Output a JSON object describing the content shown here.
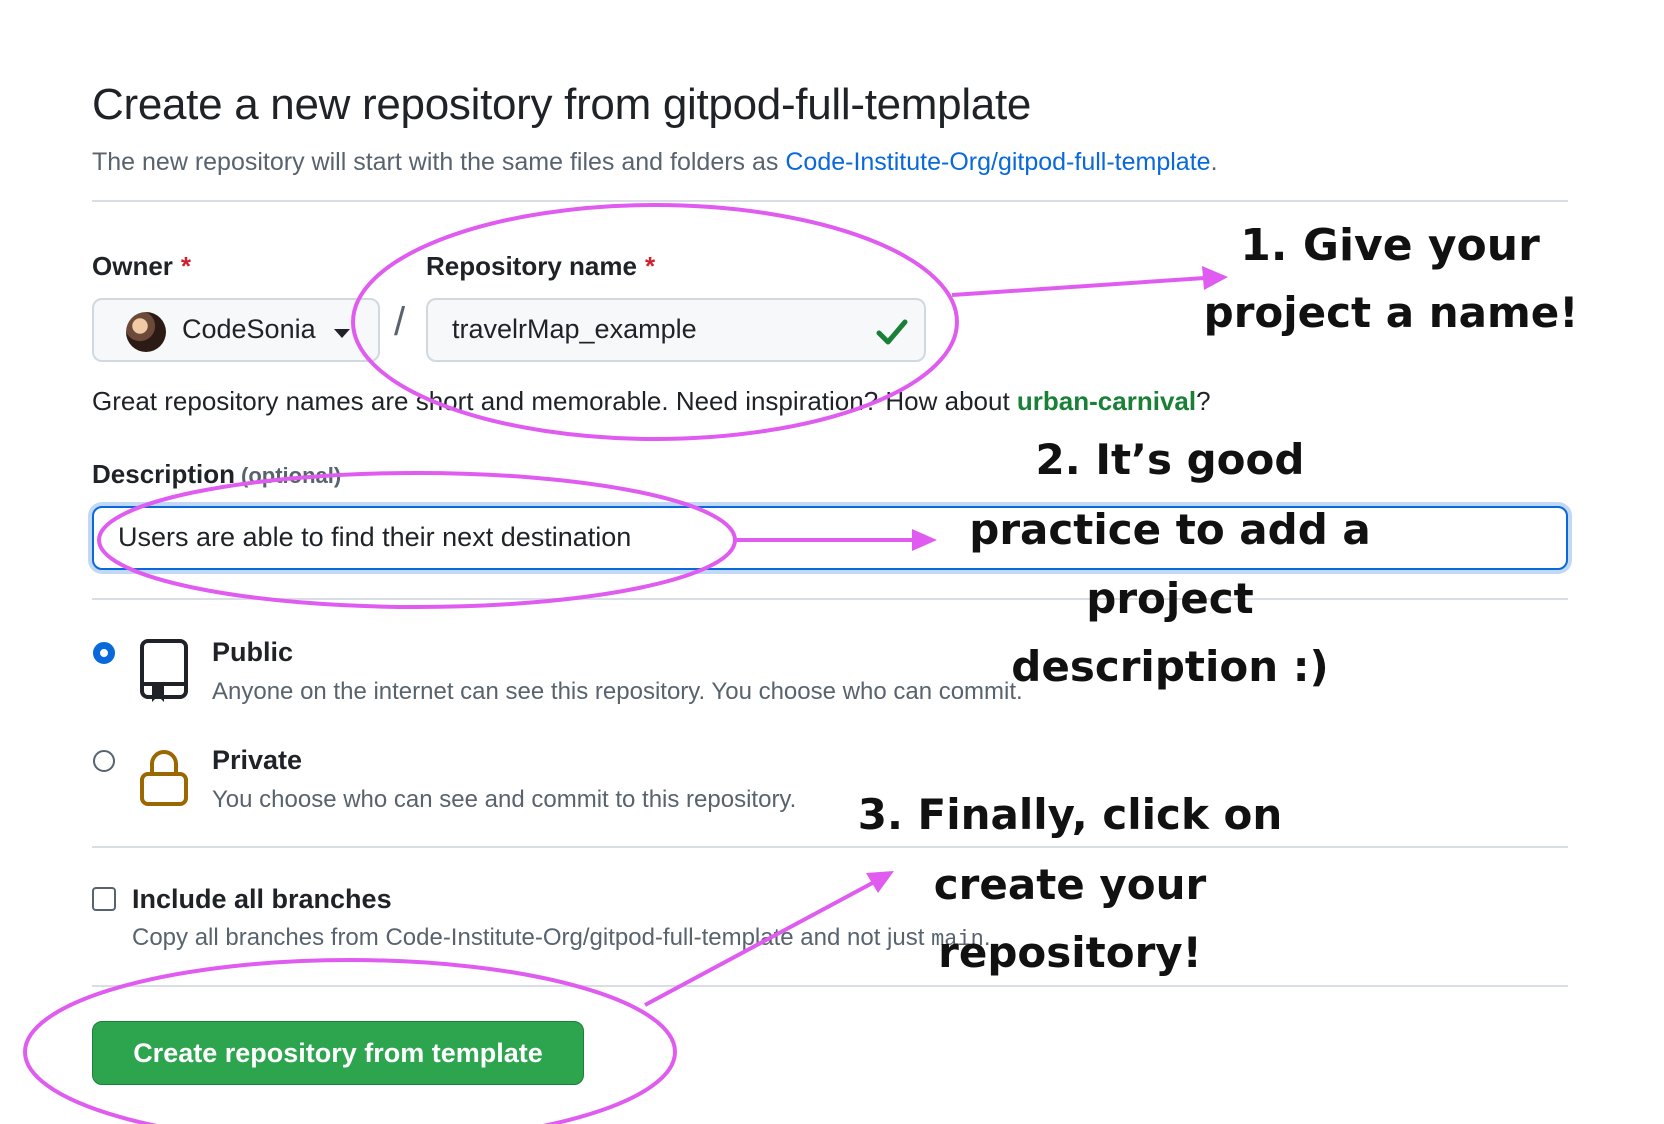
{
  "header": {
    "title": "Create a new repository from gitpod-full-template",
    "subtitle_prefix": "The new repository will start with the same files and folders as ",
    "template_link": "Code-Institute-Org/gitpod-full-template",
    "subtitle_suffix": "."
  },
  "owner": {
    "label": "Owner",
    "required_mark": "*",
    "selected": "CodeSonia"
  },
  "separator": "/",
  "repository": {
    "label": "Repository name",
    "required_mark": "*",
    "value": "travelrMap_example",
    "valid_icon": "check-icon"
  },
  "hint": {
    "prefix": "Great repository names are short and memorable. Need inspiration? How about ",
    "suggestion": "urban-carnival",
    "suffix": "?"
  },
  "description": {
    "label": "Description",
    "optional_text": "(optional)",
    "value": "Users are able to find their next destination"
  },
  "visibility": {
    "options": [
      {
        "title": "Public",
        "description": "Anyone on the internet can see this repository. You choose who can commit.",
        "icon": "repo-book-icon",
        "checked": true
      },
      {
        "title": "Private",
        "description": "You choose who can see and commit to this repository.",
        "icon": "lock-icon",
        "checked": false
      }
    ]
  },
  "branches": {
    "label": "Include all branches",
    "description_prefix": "Copy all branches from Code-Institute-Org/gitpod-full-template and not just ",
    "branch_code": "main",
    "description_suffix": ".",
    "checked": false
  },
  "submit": {
    "label": "Create repository from template"
  },
  "annotations": {
    "step1_line1": "1. Give your",
    "step1_line2": "project a name!",
    "step2_line1": "2. It’s good",
    "step2_line2": "practice to add a",
    "step2_line3": "project",
    "step2_line4": "description :)",
    "step3_line1": "3. Finally, click on",
    "step3_line2": "create your",
    "step3_line3": "repository!",
    "color": "#e05cf0"
  },
  "colors": {
    "link": "#0969da",
    "suggestion": "#1a7f37",
    "required": "#cf222e",
    "primary_button": "#2da44e",
    "focus_border": "#0969da"
  }
}
